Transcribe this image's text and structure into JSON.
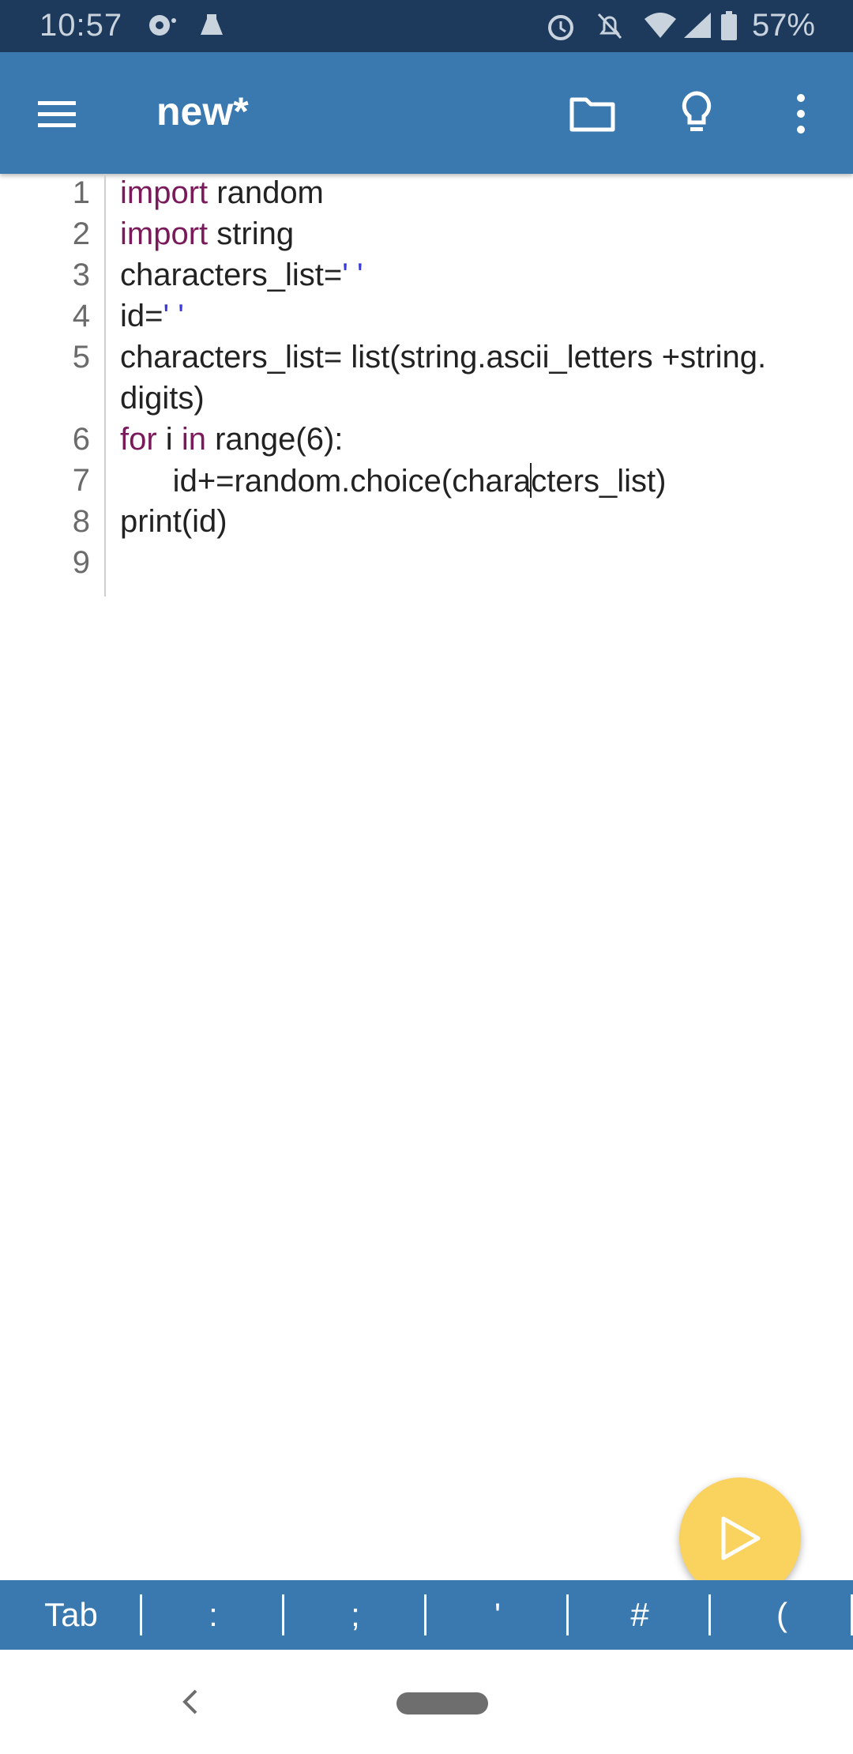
{
  "status_bar": {
    "time": "10:57",
    "battery": "57%",
    "icons": [
      "notification-icon",
      "app-icon",
      "alarm-icon",
      "mute-icon",
      "wifi-icon",
      "signal-icon",
      "battery-icon"
    ]
  },
  "app_bar": {
    "title": "new*",
    "actions": [
      "menu-icon",
      "folder-icon",
      "lightbulb-icon",
      "more-vert-icon"
    ]
  },
  "editor": {
    "line_numbers": [
      "1",
      "2",
      "3",
      "4",
      "5",
      "6",
      "7",
      "8",
      "9"
    ],
    "code": {
      "l1_kw": "import",
      "l1_rest": " random",
      "l2_kw": "import",
      "l2_rest": " string",
      "l3_a": "characters_list=",
      "l3_str": "' '",
      "l4_a": "id=",
      "l4_str": "' '",
      "l5_a": "characters_list= list(string.ascii_letters +string.",
      "l5_b": "digits)",
      "l6_kw1": "for",
      "l6_mid": " i ",
      "l6_kw2": "in",
      "l6_rest": " range(6):",
      "l7_a": "      id+=random.choice(chara",
      "l7_b": "cters_list)",
      "l8": "print(id)"
    }
  },
  "fab": {
    "icon": "play-icon"
  },
  "key_row": [
    "Tab",
    ":",
    ";",
    "'",
    "#",
    "("
  ],
  "colors": {
    "status_bar": "#1d3a5c",
    "app_bar": "#3a78b0",
    "keyword": "#7a1a5b",
    "string": "#3a3ad8",
    "fab": "#f9d35e"
  }
}
